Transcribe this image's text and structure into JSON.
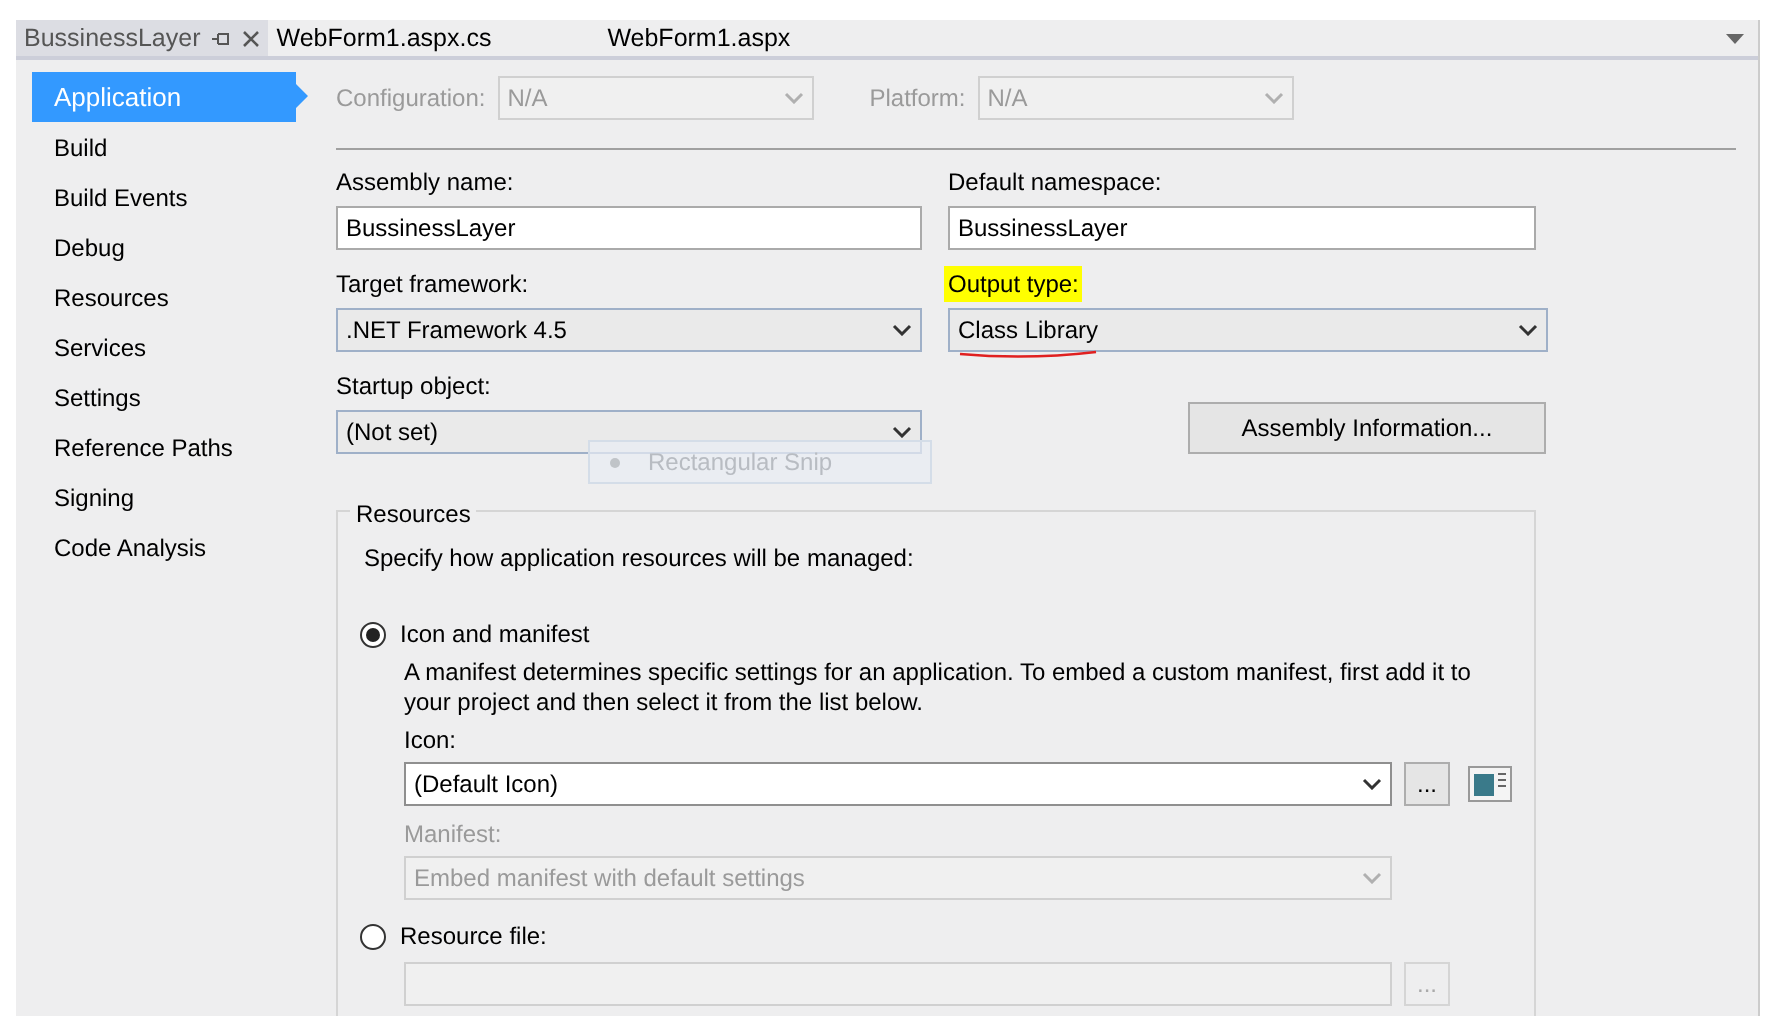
{
  "tabs": [
    {
      "label": "BussinessLayer",
      "selected": true,
      "pinned": true
    },
    {
      "label": "WebForm1.aspx.cs",
      "selected": false,
      "pinned": false
    },
    {
      "label": "WebForm1.aspx",
      "selected": false,
      "pinned": false
    }
  ],
  "sidebar": {
    "items": [
      {
        "label": "Application",
        "selected": true
      },
      {
        "label": "Build",
        "selected": false
      },
      {
        "label": "Build Events",
        "selected": false
      },
      {
        "label": "Debug",
        "selected": false
      },
      {
        "label": "Resources",
        "selected": false
      },
      {
        "label": "Services",
        "selected": false
      },
      {
        "label": "Settings",
        "selected": false
      },
      {
        "label": "Reference Paths",
        "selected": false
      },
      {
        "label": "Signing",
        "selected": false
      },
      {
        "label": "Code Analysis",
        "selected": false
      }
    ]
  },
  "configuration": {
    "label": "Configuration:",
    "value": "N/A",
    "disabled": true
  },
  "platform": {
    "label": "Platform:",
    "value": "N/A",
    "disabled": true
  },
  "assembly_name": {
    "label": "Assembly name:",
    "value": "BussinessLayer"
  },
  "default_namespace": {
    "label": "Default namespace:",
    "value": "BussinessLayer"
  },
  "target_framework": {
    "label": "Target framework:",
    "value": ".NET Framework 4.5"
  },
  "output_type": {
    "label": "Output type:",
    "value": "Class Library",
    "highlighted": true,
    "underlined": true
  },
  "startup_object": {
    "label": "Startup object:",
    "value": "(Not set)"
  },
  "snip_overlay": {
    "label": "Rectangular Snip"
  },
  "assembly_info_button": "Assembly Information...",
  "resources": {
    "title": "Resources",
    "description": "Specify how application resources will be managed:",
    "icon_and_manifest": {
      "label": "Icon and manifest",
      "selected": true,
      "note": "A manifest determines specific settings for an application. To embed a custom manifest, first add it to your project and then select it from the list below.",
      "icon_label": "Icon:",
      "icon_value": "(Default Icon)",
      "browse": "...",
      "manifest_label": "Manifest:",
      "manifest_value": "Embed manifest with default settings",
      "manifest_disabled": true
    },
    "resource_file": {
      "label": "Resource file:",
      "selected": false,
      "browse": "...",
      "disabled": true
    }
  }
}
